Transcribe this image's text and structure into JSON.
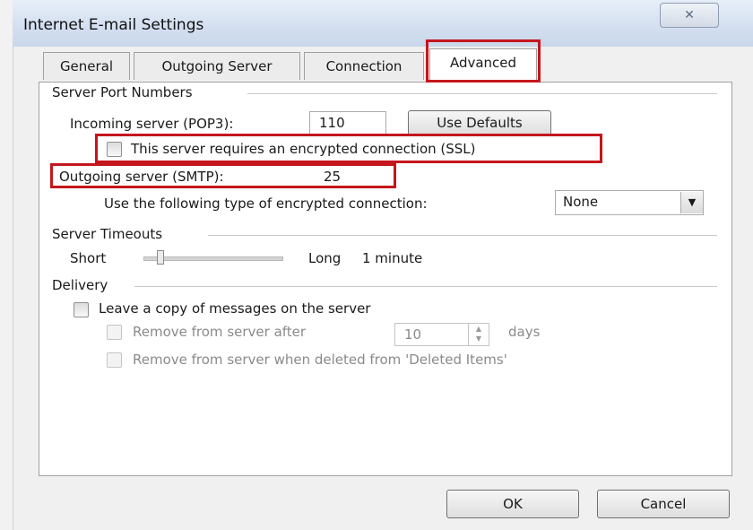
{
  "window": {
    "title": "Internet E-mail Settings",
    "close_glyph": "✕"
  },
  "tabs": [
    {
      "label": "General"
    },
    {
      "label": "Outgoing Server"
    },
    {
      "label": "Connection"
    },
    {
      "label": "Advanced",
      "active": true
    }
  ],
  "server_ports": {
    "group_label": "Server Port Numbers",
    "incoming_label": "Incoming server (POP3):",
    "incoming_value": "110",
    "use_defaults_label": "Use Defaults",
    "ssl_label": "This server requires an encrypted connection (SSL)",
    "ssl_checked": false,
    "outgoing_label": "Outgoing server (SMTP):",
    "outgoing_value": "25",
    "encryption_label": "Use the following type of encrypted connection:",
    "encryption_value": "None"
  },
  "timeouts": {
    "group_label": "Server Timeouts",
    "short_label": "Short",
    "long_label": "Long",
    "value_label": "1 minute",
    "level": 0.1
  },
  "delivery": {
    "group_label": "Delivery",
    "leave_copy_label": "Leave a copy of messages on the server",
    "remove_after_label": "Remove from server after",
    "remove_after_days": "10",
    "days_label": "days",
    "remove_deleted_label": "Remove from server when deleted from 'Deleted Items'"
  },
  "buttons": {
    "ok_label": "OK",
    "cancel_label": "Cancel"
  },
  "colors": {
    "highlight": "#c4161c",
    "titlebar": "#d3dff0"
  }
}
